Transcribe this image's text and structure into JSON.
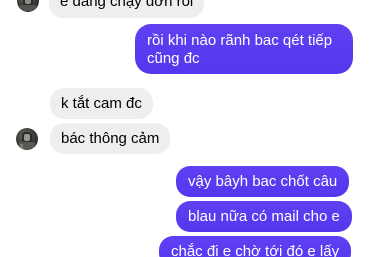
{
  "conversation": {
    "messages": [
      {
        "sender": "other",
        "text": "e đang chạy đơn rồi",
        "clipped": "top"
      },
      {
        "sender": "me",
        "lines": [
          "rồi khi nào rãnh bac qét tiếp",
          "cũng đc"
        ]
      },
      {
        "sender": "other",
        "text": "k tắt cam đc"
      },
      {
        "sender": "other",
        "text": "bác thông cảm"
      },
      {
        "sender": "me",
        "text": "vậy bâyh bac chốt câu"
      },
      {
        "sender": "me",
        "text": "blau nữa có mail cho e"
      },
      {
        "sender": "me",
        "text": "chắc đi e chờ tới đó e lấy",
        "clipped": "bottom"
      }
    ]
  }
}
